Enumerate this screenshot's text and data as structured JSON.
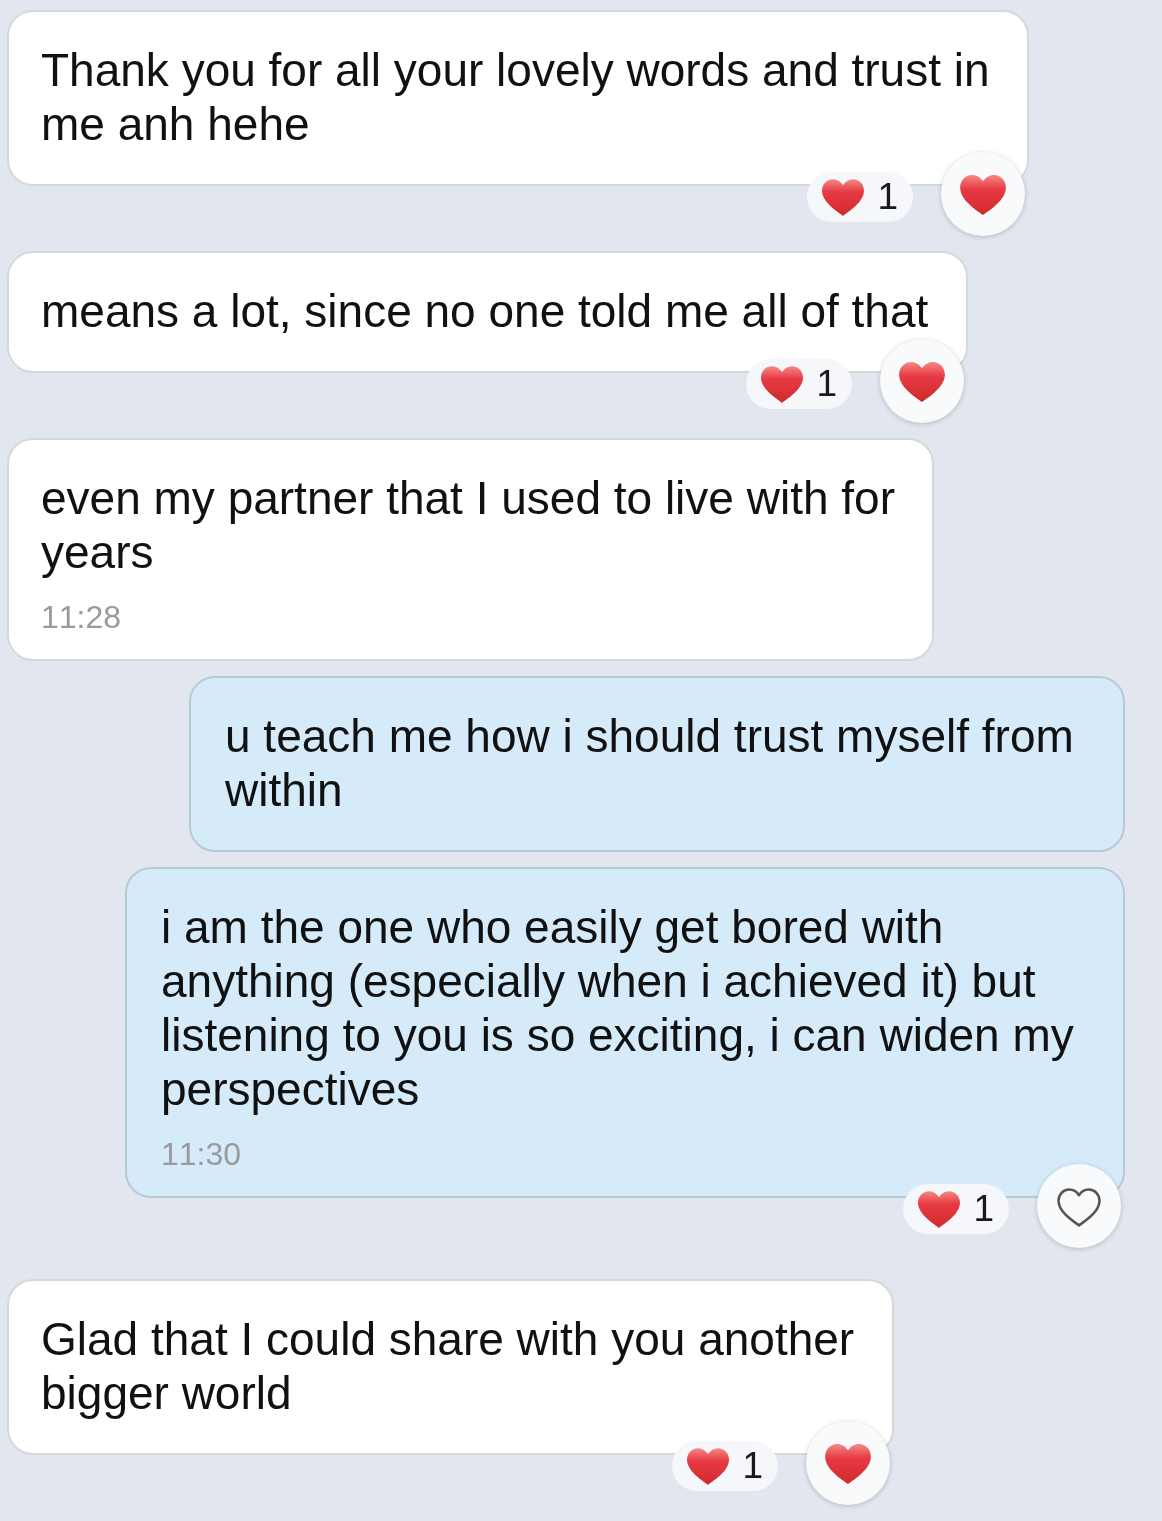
{
  "messages": [
    {
      "kind": "incoming",
      "text": "Thank you for all your lovely words and trust in me anh hehe",
      "reaction": {
        "count": "1",
        "reacted": true
      }
    },
    {
      "kind": "incoming",
      "text": "means a lot, since no one told me all of that",
      "reaction": {
        "count": "1",
        "reacted": true
      }
    },
    {
      "kind": "incoming",
      "text": "even my partner that I used to live with for years",
      "time": "11:28"
    },
    {
      "kind": "outgoing",
      "text": "u teach me how i should trust myself from within"
    },
    {
      "kind": "outgoing",
      "text": "i am the one who easily get bored with anything (especially when i achieved it) but listening to you is so exciting, i can widen my perspectives",
      "time": "11:30",
      "reaction": {
        "count": "1",
        "reacted": false
      }
    },
    {
      "kind": "incoming",
      "text": "Glad that I could share with you another bigger world",
      "reaction": {
        "count": "1",
        "reacted": true
      }
    }
  ]
}
